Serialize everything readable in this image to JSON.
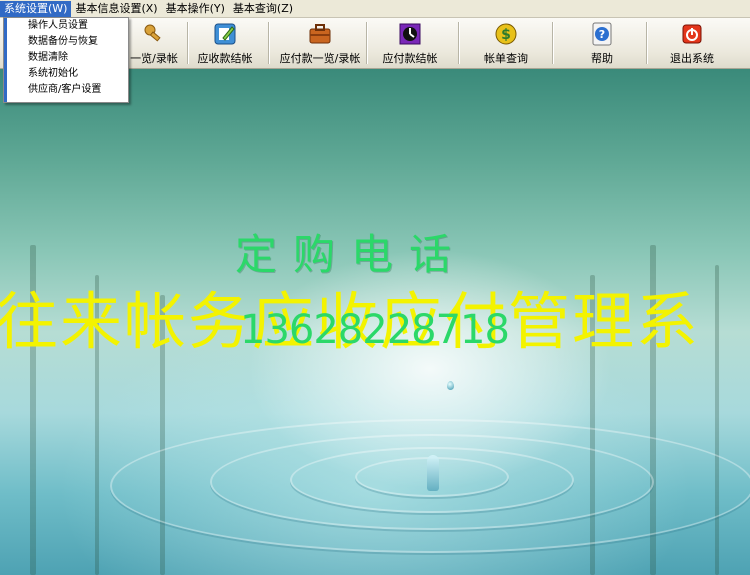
{
  "menubar": {
    "items": [
      {
        "label": "系统设置(W)"
      },
      {
        "label": "基本信息设置(X)"
      },
      {
        "label": "基本操作(Y)"
      },
      {
        "label": "基本查询(Z)"
      }
    ]
  },
  "dropdown": {
    "items": [
      {
        "label": "操作人员设置"
      },
      {
        "label": "数据备份与恢复"
      },
      {
        "label": "数据清除"
      },
      {
        "label": "系统初始化"
      },
      {
        "label": "供应商/客户设置"
      }
    ]
  },
  "toolbar": {
    "buttons": [
      {
        "label": "一览/录帐",
        "icon": "key-icon"
      },
      {
        "label": "应收款结帐",
        "icon": "edit-icon"
      },
      {
        "label": "应付款一览/录帐",
        "icon": "briefcase-icon"
      },
      {
        "label": "应付款结帐",
        "icon": "clock-icon"
      },
      {
        "label": "帐单查询",
        "icon": "money-icon"
      },
      {
        "label": "帮助",
        "icon": "help-icon"
      },
      {
        "label": "退出系统",
        "icon": "power-icon"
      }
    ]
  },
  "banner": {
    "order_label": "定购电话",
    "app_title": "往来帐务应收应付管理系",
    "phone": "13628228718"
  },
  "colors": {
    "menu_highlight": "#316ac5",
    "order_text": "#2bd869",
    "title_text": "#f3f300"
  }
}
